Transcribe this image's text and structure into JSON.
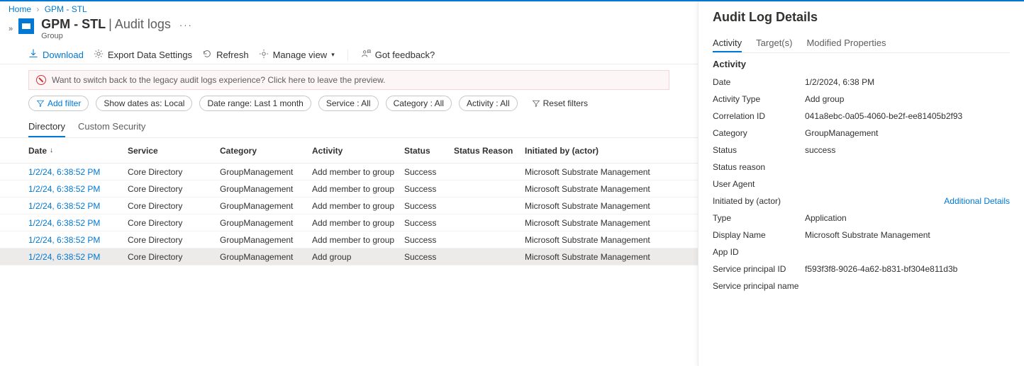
{
  "breadcrumb": {
    "home": "Home",
    "current": "GPM - STL"
  },
  "header": {
    "title": "GPM - STL",
    "section": "| Audit logs",
    "subtype": "Group"
  },
  "toolbar": {
    "download": "Download",
    "export": "Export Data Settings",
    "refresh": "Refresh",
    "manage": "Manage view",
    "feedback": "Got feedback?"
  },
  "notice": "Want to switch back to the legacy audit logs experience? Click here to leave the preview.",
  "filters": {
    "add": "Add filter",
    "datefmt": "Show dates as: Local",
    "range": "Date range: Last 1 month",
    "service": "Service : All",
    "category": "Category : All",
    "activity": "Activity : All",
    "reset": "Reset filters"
  },
  "tabs": {
    "directory": "Directory",
    "custom": "Custom Security"
  },
  "columns": {
    "date": "Date",
    "service": "Service",
    "category": "Category",
    "activity": "Activity",
    "status": "Status",
    "reason": "Status Reason",
    "actor": "Initiated by (actor)"
  },
  "rows": [
    {
      "date": "1/2/24, 6:38:52 PM",
      "service": "Core Directory",
      "category": "GroupManagement",
      "activity": "Add member to group",
      "status": "Success",
      "reason": "",
      "actor": "Microsoft Substrate Management"
    },
    {
      "date": "1/2/24, 6:38:52 PM",
      "service": "Core Directory",
      "category": "GroupManagement",
      "activity": "Add member to group",
      "status": "Success",
      "reason": "",
      "actor": "Microsoft Substrate Management"
    },
    {
      "date": "1/2/24, 6:38:52 PM",
      "service": "Core Directory",
      "category": "GroupManagement",
      "activity": "Add member to group",
      "status": "Success",
      "reason": "",
      "actor": "Microsoft Substrate Management"
    },
    {
      "date": "1/2/24, 6:38:52 PM",
      "service": "Core Directory",
      "category": "GroupManagement",
      "activity": "Add member to group",
      "status": "Success",
      "reason": "",
      "actor": "Microsoft Substrate Management"
    },
    {
      "date": "1/2/24, 6:38:52 PM",
      "service": "Core Directory",
      "category": "GroupManagement",
      "activity": "Add member to group",
      "status": "Success",
      "reason": "",
      "actor": "Microsoft Substrate Management"
    },
    {
      "date": "1/2/24, 6:38:52 PM",
      "service": "Core Directory",
      "category": "GroupManagement",
      "activity": "Add group",
      "status": "Success",
      "reason": "",
      "actor": "Microsoft Substrate Management"
    }
  ],
  "details": {
    "title": "Audit Log Details",
    "tabs": {
      "activity": "Activity",
      "targets": "Target(s)",
      "modified": "Modified Properties"
    },
    "section": "Activity",
    "items": {
      "date_k": "Date",
      "date_v": "1/2/2024, 6:38 PM",
      "type_k": "Activity Type",
      "type_v": "Add group",
      "corr_k": "Correlation ID",
      "corr_v": "041a8ebc-0a05-4060-be2f-ee81405b2f93",
      "cat_k": "Category",
      "cat_v": "GroupManagement",
      "status_k": "Status",
      "status_v": "success",
      "reason_k": "Status reason",
      "reason_v": "",
      "agent_k": "User Agent",
      "agent_v": "",
      "init_k": "Initiated by (actor)",
      "addl": "Additional Details",
      "itype_k": "Type",
      "itype_v": "Application",
      "dname_k": "Display Name",
      "dname_v": "Microsoft Substrate Management",
      "appid_k": "App ID",
      "appid_v": "",
      "spid_k": "Service principal ID",
      "spid_v": "f593f3f8-9026-4a62-b831-bf304e811d3b",
      "spn_k": "Service principal name",
      "spn_v": ""
    }
  }
}
